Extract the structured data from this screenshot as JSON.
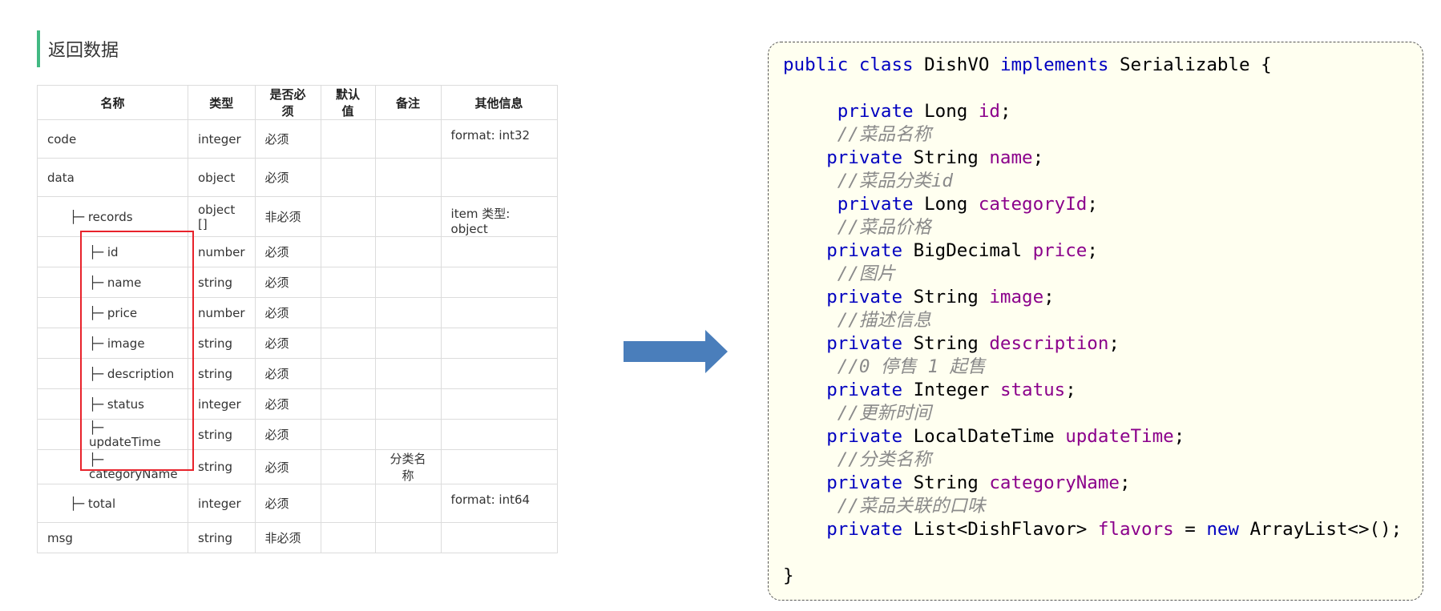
{
  "section": {
    "title": "返回数据"
  },
  "table": {
    "headers": [
      "名称",
      "类型",
      "是否必须",
      "默认值",
      "备注",
      "其他信息"
    ],
    "rows": [
      {
        "name": "code",
        "type": "integer",
        "required": "必须",
        "default": "",
        "remark": "",
        "other": "format: int32"
      },
      {
        "name": "data",
        "type": "object",
        "required": "必须",
        "default": "",
        "remark": "",
        "other": ""
      },
      {
        "name": "├─ records",
        "type": "object []",
        "required": "非必须",
        "default": "",
        "remark": "",
        "other": "item 类型: object"
      },
      {
        "name": "├─ id",
        "type": "number",
        "required": "必须",
        "default": "",
        "remark": "",
        "other": ""
      },
      {
        "name": "├─ name",
        "type": "string",
        "required": "必须",
        "default": "",
        "remark": "",
        "other": ""
      },
      {
        "name": "├─ price",
        "type": "number",
        "required": "必须",
        "default": "",
        "remark": "",
        "other": ""
      },
      {
        "name": "├─ image",
        "type": "string",
        "required": "必须",
        "default": "",
        "remark": "",
        "other": ""
      },
      {
        "name": "├─ description",
        "type": "string",
        "required": "必须",
        "default": "",
        "remark": "",
        "other": ""
      },
      {
        "name": "├─ status",
        "type": "integer",
        "required": "必须",
        "default": "",
        "remark": "",
        "other": ""
      },
      {
        "name": "├─ updateTime",
        "type": "string",
        "required": "必须",
        "default": "",
        "remark": "",
        "other": ""
      },
      {
        "name": "├─ categoryName",
        "type": "string",
        "required": "必须",
        "default": "",
        "remark": "分类名称",
        "other": ""
      },
      {
        "name": "├─ total",
        "type": "integer",
        "required": "必须",
        "default": "",
        "remark": "",
        "other": "format: int64"
      },
      {
        "name": "msg",
        "type": "string",
        "required": "非必须",
        "default": "",
        "remark": "",
        "other": ""
      }
    ]
  },
  "code": {
    "l1": {
      "kw1": "public",
      "kw2": "class",
      "name": "DishVO",
      "kw3": "implements",
      "iface": "Serializable",
      "brace": "{"
    },
    "f0": {
      "kw": "private",
      "type": "Long",
      "name": "id",
      "end": ";"
    },
    "c1": "//菜品名称",
    "f1": {
      "kw": "private",
      "type": "String",
      "name": "name",
      "end": ";"
    },
    "c2": "//菜品分类id",
    "f2": {
      "kw": "private",
      "type": "Long",
      "name": "categoryId",
      "end": ";"
    },
    "c3": "//菜品价格",
    "f3": {
      "kw": "private",
      "type": "BigDecimal",
      "name": "price",
      "end": ";"
    },
    "c4": "//图片",
    "f4": {
      "kw": "private",
      "type": "String",
      "name": "image",
      "end": ";"
    },
    "c5": "//描述信息",
    "f5": {
      "kw": "private",
      "type": "String",
      "name": "description",
      "end": ";"
    },
    "c6": "//0 停售 1 起售",
    "f6": {
      "kw": "private",
      "type": "Integer",
      "name": "status",
      "end": ";"
    },
    "c7": "//更新时间",
    "f7": {
      "kw": "private",
      "type": "LocalDateTime",
      "name": "updateTime",
      "end": ";"
    },
    "c8": "//分类名称",
    "f8": {
      "kw": "private",
      "type": "String",
      "name": "categoryName",
      "end": ";"
    },
    "c9": "//菜品关联的口味",
    "f9": {
      "kw": "private",
      "type": "List<DishFlavor>",
      "name": "flavors",
      "op": "=",
      "kw2": "new",
      "init": "ArrayList<>();"
    },
    "close": "}"
  },
  "colors": {
    "accent": "#42b983",
    "highlight": "#e8232b",
    "arrow": "#4a7ebb",
    "keyword": "#0000c0",
    "field": "#8b008b",
    "comment": "#8a8a8a",
    "code_bg": "#fffff0"
  }
}
